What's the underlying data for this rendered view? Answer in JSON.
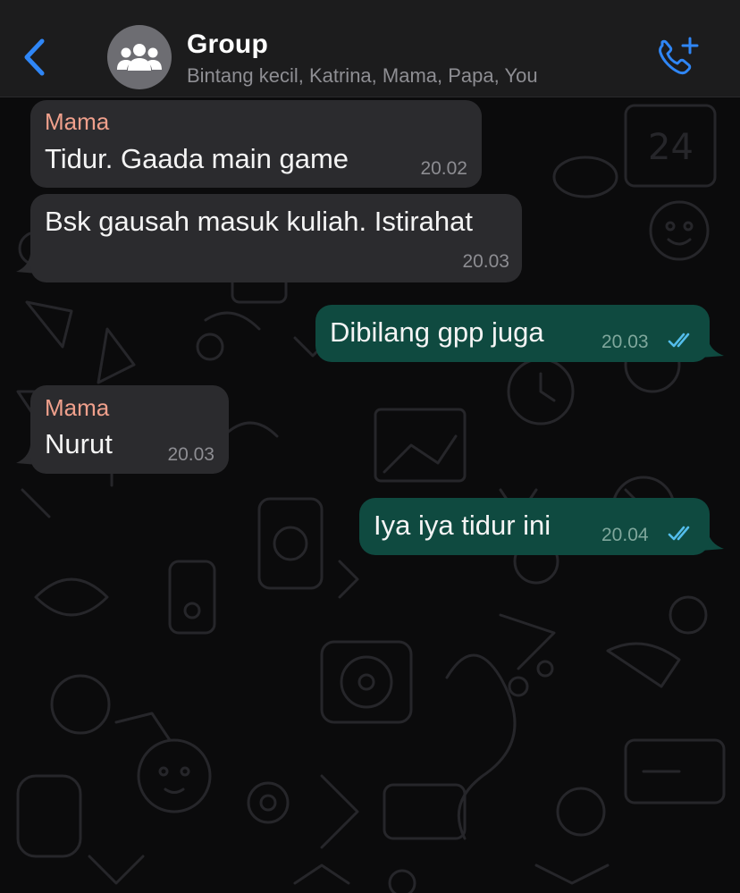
{
  "header": {
    "back_icon": "chevron-left-icon",
    "avatar_icon": "group-avatar-icon",
    "title": "Group",
    "subtitle": "Bintang kecil, Katrina, Mama, Papa, You",
    "call_icon": "add-call-icon"
  },
  "colors": {
    "accent": "#2f86f6",
    "incoming_bubble": "#2b2b2e",
    "outgoing_bubble": "#0f4a40",
    "sender_name": "#f0a08c",
    "read_ticks": "#53bdeb"
  },
  "messages": [
    {
      "direction": "incoming",
      "sender": "Mama",
      "text": "Tidur. Gaada main game",
      "time": "20.02"
    },
    {
      "direction": "incoming",
      "sender": "",
      "text": "Bsk gausah masuk kuliah. Istirahat",
      "time": "20.03"
    },
    {
      "direction": "outgoing",
      "text": "Dibilang gpp juga",
      "time": "20.03",
      "status": "read"
    },
    {
      "direction": "incoming",
      "sender": "Mama",
      "text": "Nurut",
      "time": "20.03"
    },
    {
      "direction": "outgoing",
      "text": "Iya iya tidur ini",
      "time": "20.04",
      "status": "read"
    }
  ]
}
